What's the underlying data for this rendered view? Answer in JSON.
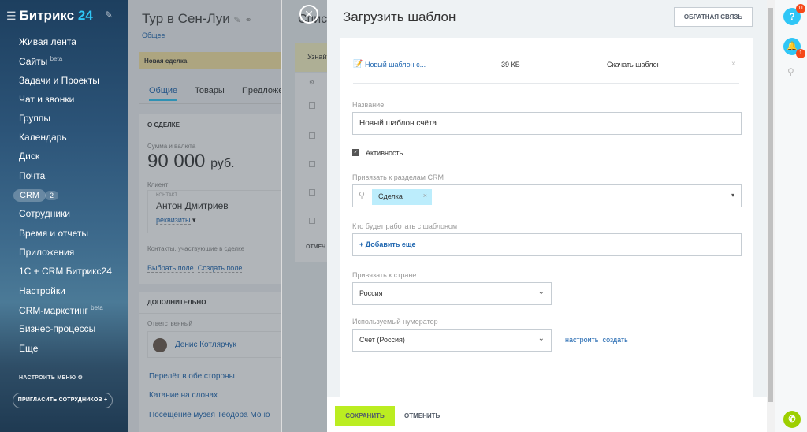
{
  "sidebar": {
    "logo_text": "Битрикс",
    "logo_num": "24",
    "items": [
      {
        "label": "Живая лента"
      },
      {
        "label": "Сайты",
        "sup": "beta"
      },
      {
        "label": "Задачи и Проекты"
      },
      {
        "label": "Чат и звонки"
      },
      {
        "label": "Группы"
      },
      {
        "label": "Календарь"
      },
      {
        "label": "Диск"
      },
      {
        "label": "Почта"
      },
      {
        "label": "CRM",
        "count": "2"
      },
      {
        "label": "Сотрудники"
      },
      {
        "label": "Время и отчеты"
      },
      {
        "label": "Приложения"
      },
      {
        "label": "1С + CRM Битрикс24"
      },
      {
        "label": "Настройки"
      },
      {
        "label": "CRM-маркетинг",
        "sup": "beta"
      },
      {
        "label": "Бизнес-процессы"
      },
      {
        "label": "Еще"
      }
    ],
    "configure_menu": "НАСТРОИТЬ МЕНЮ",
    "invite": "ПРИГЛАСИТЬ СОТРУДНИКОВ"
  },
  "deal": {
    "title": "Тур в Сен-Луи",
    "subtitle": "Общее",
    "stage": "Новая сделка",
    "tabs": [
      "Общие",
      "Товары",
      "Предложе"
    ],
    "about_header": "О СДЕЛКЕ",
    "amount_label": "Сумма и валюта",
    "amount": "90 000",
    "currency": "руб.",
    "client_label": "Клиент",
    "contact_caption": "контакт",
    "contact_name": "Антон Дмитриев",
    "requisites": "реквизиты",
    "contacts_note": "Контакты, участвующие в сделке",
    "choose_field": "Выбрать поле",
    "create_field": "Создать поле",
    "extra_header": "ДОПОЛНИТЕЛЬНО",
    "responsible_label": "Ответственный",
    "responsible_name": "Денис Котлярчук",
    "links": [
      "Перелёт в обе стороны",
      "Катание на слонах",
      "Посещение музея Теодора Моно"
    ]
  },
  "second": {
    "title_frag": "Спис",
    "learn": "Узнайт",
    "mark": "ОТМЕЧ"
  },
  "slider": {
    "title": "Загрузить шаблон",
    "feedback": "ОБРАТНАЯ СВЯЗЬ",
    "file_name": "Новый шаблон с...",
    "file_size": "39 КБ",
    "download": "Скачать шаблон",
    "name_label": "Название",
    "name_value": "Новый шаблон счёта",
    "active_label": "Активность",
    "bind_crm_label": "Привязать к разделам CRM",
    "crm_chip": "Сделка",
    "who_label": "Кто будет работать с шаблоном",
    "add_more": "+ Добавить еще",
    "country_label": "Привязать к стране",
    "country_value": "Россия",
    "numerator_label": "Используемый нумератор",
    "numerator_value": "Счет (Россия)",
    "configure": "настроить",
    "create": "создать",
    "save": "СОХРАНИТЬ",
    "cancel": "ОТМЕНИТЬ"
  },
  "rightbar": {
    "help": "?",
    "help_badge": "11",
    "notif_badge": "1"
  },
  "colors": {
    "accent": "#2fc6f6",
    "link": "#2067b0",
    "save": "#bbed21",
    "badge": "#f54819",
    "phone": "#9dcf00"
  }
}
